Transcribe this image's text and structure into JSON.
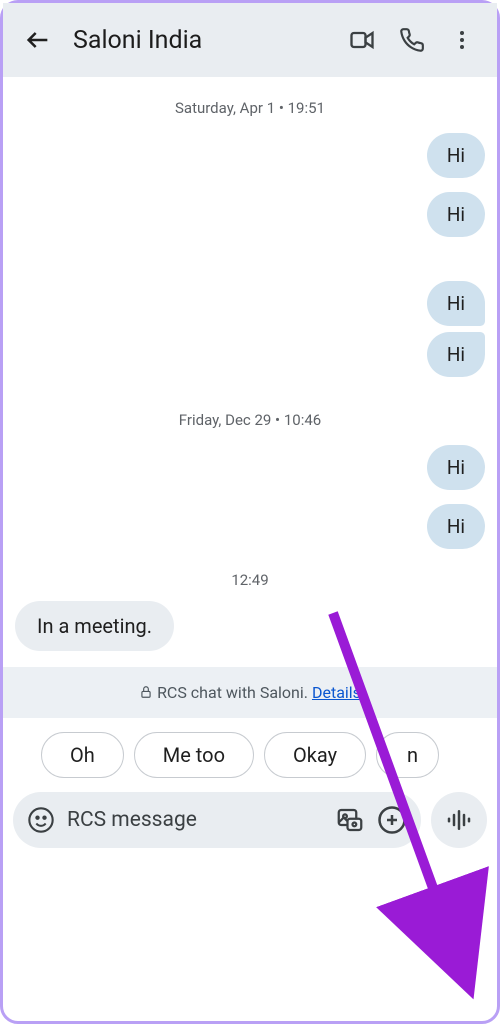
{
  "header": {
    "title": "Saloni India"
  },
  "dates": {
    "d1": "Saturday, Apr 1 • 19:51",
    "d2": "Friday, Dec 29 • 10:46",
    "t1": "12:49"
  },
  "msgs": {
    "hi": "Hi",
    "meeting": "In a meeting."
  },
  "banner": {
    "text": "RCS chat with Saloni. ",
    "details": "Details"
  },
  "suggestions": {
    "s1": "Oh",
    "s2": "Me too",
    "s3": "Okay"
  },
  "composer": {
    "placeholder": "RCS message"
  }
}
